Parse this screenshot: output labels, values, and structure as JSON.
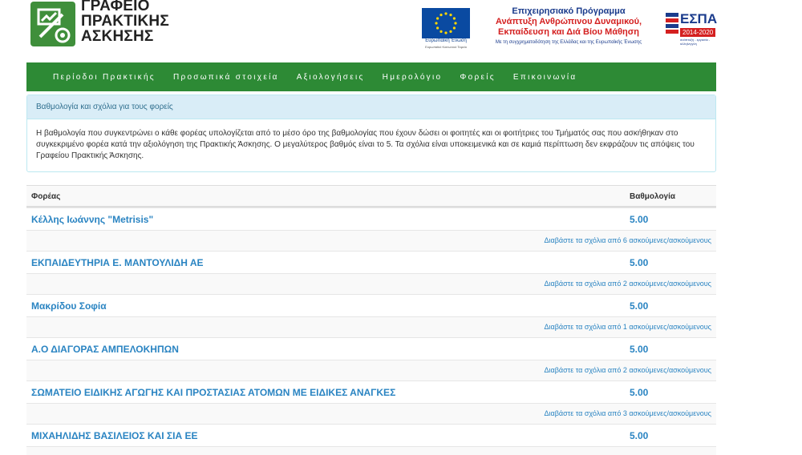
{
  "header": {
    "logo_lines": [
      "ΓΡΑΦΕΙΟ",
      "ΠΡΑΚΤΙΚΗΣ",
      "ΑΣΚΗΣΗΣ"
    ],
    "eu_caption": "Ευρωπαϊκή Ένωση",
    "eu_subcaption": "Ευρωπαϊκό Κοινωνικό Ταμείο",
    "program_line1": "Επιχειρησιακό Πρόγραμμα",
    "program_line2": "Ανάπτυξη Ανθρώπινου Δυναμικού,",
    "program_line3": "Εκπαίδευση και Διά Βίου Μάθηση",
    "program_funding": "Με τη συγχρηματοδότηση της Ελλάδας και της Ευρωπαϊκής Ένωσης",
    "espa_title": "ΕΣΠΑ",
    "espa_years": "2014-2020",
    "espa_small": "ανάπτυξη - εργασία - αλληλεγγύη",
    "colors": {
      "brand_green": "#2d8a35",
      "eu_blue": "#0a4aa1",
      "espa_red": "#d42020"
    }
  },
  "nav": {
    "items": [
      "Περίοδοι Πρακτικής",
      "Προσωπικά στοιχεία",
      "Αξιολογήσεις",
      "Ημερολόγιο",
      "Φορείς",
      "Επικοινωνία"
    ]
  },
  "panel": {
    "heading": "Βαθμολογία και σχόλια για τους φορείς",
    "body": "Η βαθμολογία που συγκεντρώνει ο κάθε φορέας υπολογίζεται από το μέσο όρο της βαθμολογίας που έχουν δώσει οι φοιτητές και οι φοιτήτριες του Τμήματός σας που ασκήθηκαν στο συγκεκριμένο φορέα κατά την αξιολόγηση της Πρακτικής Άσκησης. Ο μεγαλύτερος βαθμός είναι το 5. Τα σχόλια είναι υποκειμενικά και σε καμιά περίπτωση δεν εκφράζουν τις απόψεις του Γραφείου Πρακτικής Άσκησης."
  },
  "table": {
    "headers": {
      "org": "Φορέας",
      "score": "Βαθμολογία"
    },
    "rows": [
      {
        "name": "Κέλλης Ιωάννης \"Metrisis\"",
        "score": "5.00",
        "comments": "Διαβάστε τα σχόλια από 6 ασκούμενες/ασκούμενους"
      },
      {
        "name": "ΕΚΠΑΙΔΕΥΤΗΡΙΑ Ε. ΜΑΝΤΟΥΛΙΔΗ ΑΕ",
        "score": "5.00",
        "comments": "Διαβάστε τα σχόλια από 2 ασκούμενες/ασκούμενους"
      },
      {
        "name": "Μακρίδου Σοφία",
        "score": "5.00",
        "comments": "Διαβάστε τα σχόλια από 1 ασκούμενες/ασκούμενους"
      },
      {
        "name": "Α.Ο ΔΙΑΓΟΡΑΣ ΑΜΠΕΛΟΚΗΠΩΝ",
        "score": "5.00",
        "comments": "Διαβάστε τα σχόλια από 2 ασκούμενες/ασκούμενους"
      },
      {
        "name": "ΣΩΜΑΤΕΙΟ ΕΙΔΙΚΗΣ ΑΓΩΓΗΣ ΚΑΙ ΠΡΟΣΤΑΣΙΑΣ ΑΤΟΜΩΝ ΜΕ ΕΙΔΙΚΕΣ ΑΝΑΓΚΕΣ",
        "score": "5.00",
        "comments": "Διαβάστε τα σχόλια από 3 ασκούμενες/ασκούμενους"
      },
      {
        "name": "ΜΙΧΑΗΛΙΔΗΣ ΒΑΣΙΛΕΙΟΣ ΚΑΙ ΣΙΑ ΕΕ",
        "score": "5.00",
        "comments": ""
      }
    ]
  }
}
